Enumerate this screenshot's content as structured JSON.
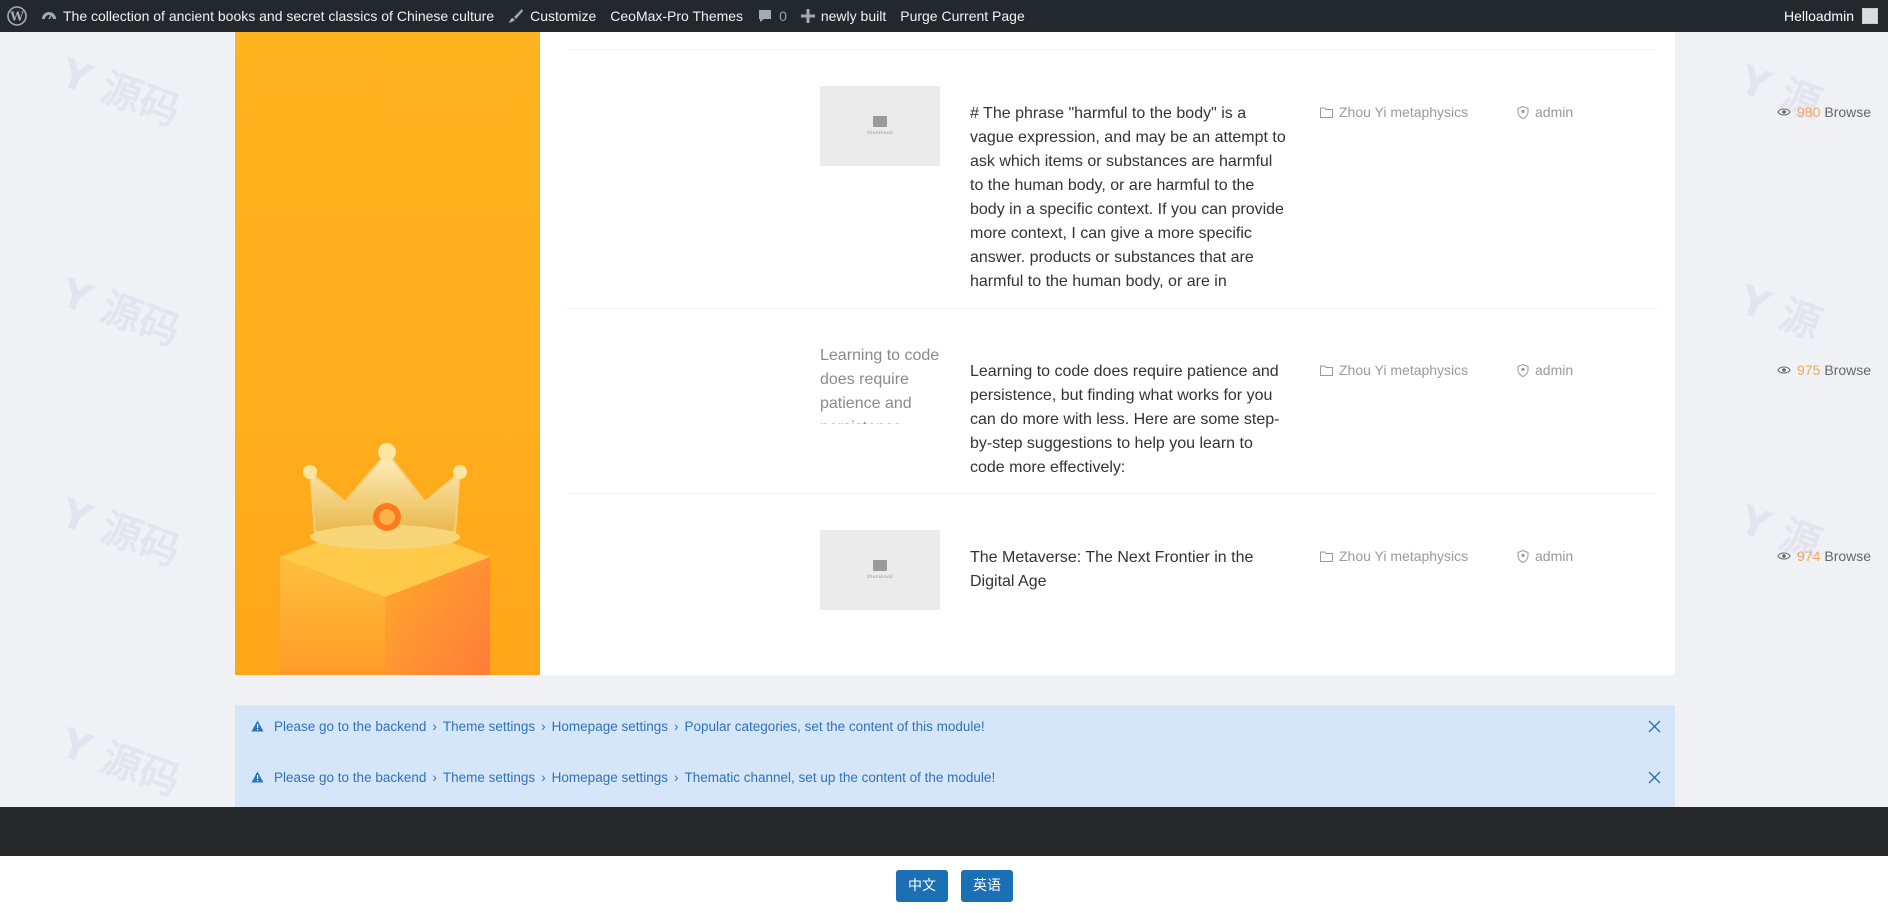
{
  "adminbar": {
    "site_title": "The collection of ancient books and secret classics of Chinese culture",
    "customize": "Customize",
    "themes": "CeoMax-Pro Themes",
    "comments_count": "0",
    "new_label": "newly built",
    "purge": "Purge Current Page",
    "user": "Helloadmin"
  },
  "posts": [
    {
      "title": "# The phrase \"harmful to the body\" is a vague expression, and may be an attempt to ask which items or substances are harmful to the human body, or are harmful to the body in a specific context. If you can provide more context, I can give a more specific answer. products or substances that are harmful to the human body, or are in",
      "thumb_label": "thumbnail",
      "category": "Zhou Yi metaphysics",
      "author": "admin",
      "views": "980",
      "views_label": "Browse"
    },
    {
      "title": "Learning to code does require patience and persistence, but finding what works for you can do more with less. Here are some step-by-step suggestions to help you learn to code more effectively:",
      "thumb_alt": "Learning to code does require patience and persistence",
      "category": "Zhou Yi metaphysics",
      "author": "admin",
      "views": "975",
      "views_label": "Browse"
    },
    {
      "title": "The Metaverse: The Next Frontier in the Digital Age",
      "thumb_label": "thumbnail",
      "category": "Zhou Yi metaphysics",
      "author": "admin",
      "views": "974",
      "views_label": "Browse"
    }
  ],
  "alerts": [
    {
      "crumbs": [
        "Please go to the backend",
        "Theme settings",
        "Homepage settings",
        "Popular categories, set the content of this module!"
      ]
    },
    {
      "crumbs": [
        "Please go to the backend",
        "Theme settings",
        "Homepage settings",
        "Thematic channel, set up the content of the module!"
      ]
    }
  ],
  "footer": {
    "lang_zh": "中文",
    "lang_en": "英语"
  },
  "colors": {
    "adminbar_bg": "#23282d",
    "banner": "#ffb31f",
    "accent_views": "#f0a75a",
    "alert_bg": "#d6e6f9",
    "alert_text": "#2f72b9",
    "button": "#1b6fb5"
  },
  "icons": [
    "wordpress-icon",
    "dashboard-icon",
    "brush-icon",
    "comment-icon",
    "plus-icon",
    "folder-icon",
    "shield-user-icon",
    "eye-icon",
    "warning-icon",
    "close-icon",
    "crown-icon",
    "image-icon"
  ]
}
